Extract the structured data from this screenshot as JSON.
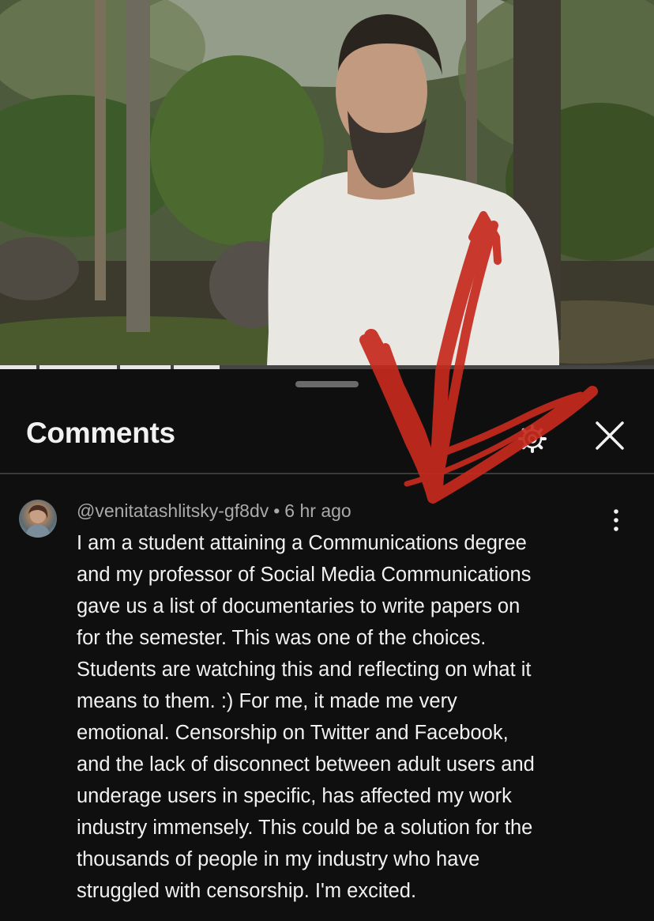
{
  "video": {
    "icon": "video-thumbnail",
    "progress_fraction": 0.34
  },
  "comments_sheet": {
    "title": "Comments",
    "settings_icon": "settings-gear-icon",
    "close_icon": "close-icon"
  },
  "comment": {
    "avatar_icon": "user-avatar",
    "author": "@venitatashlitsky-gf8dv",
    "separator": "•",
    "time": "6 hr ago",
    "more_icon": "more-vertical-icon",
    "lines": [
      "I am a student attaining a Communications degree",
      "and my professor of Social Media Communications",
      "gave us a list of documentaries to write papers on",
      "for the semester. This was one of the choices.",
      "Students are watching this and reflecting on what it",
      "means to them. :) For me, it made me very",
      "emotional. Censorship on Twitter and Facebook,",
      "and the lack of disconnect between adult users and",
      "underage users in specific, has affected my work",
      "industry immensely. This could be a solution for the",
      "thousands of people in my industry who have",
      "struggled with censorship. I'm excited."
    ]
  },
  "colors": {
    "background": "#0f0f0f",
    "annotation_red": "#c62a1e"
  }
}
